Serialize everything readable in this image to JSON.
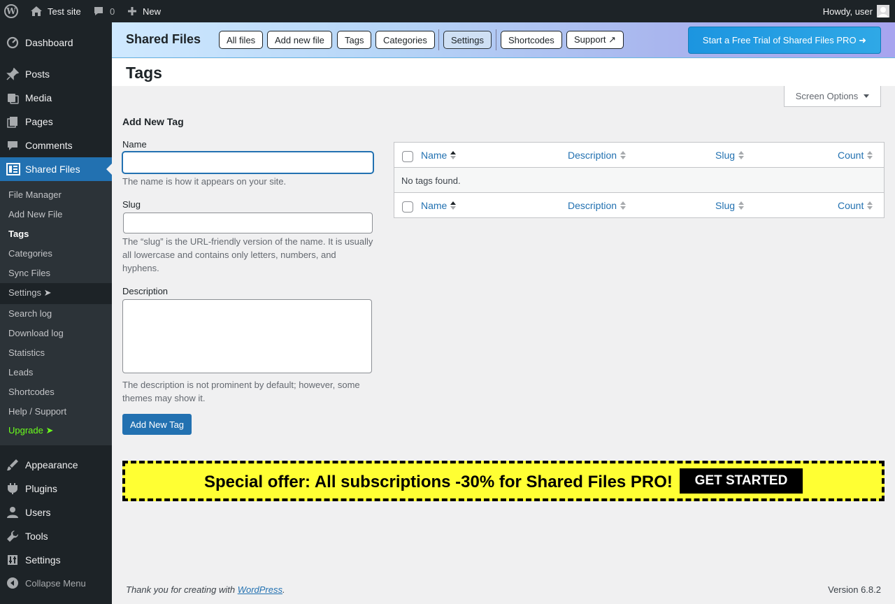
{
  "adminbar": {
    "site_name": "Test site",
    "comments_count": "0",
    "new_label": "New",
    "greeting": "Howdy, user"
  },
  "sidebar": {
    "top_items": [
      {
        "label": "Dashboard",
        "icon": "dashboard-icon"
      },
      {
        "label": "Posts",
        "icon": "pushpin-icon"
      },
      {
        "label": "Media",
        "icon": "media-icon"
      },
      {
        "label": "Pages",
        "icon": "pages-icon"
      },
      {
        "label": "Comments",
        "icon": "comment-icon"
      },
      {
        "label": "Shared Files",
        "icon": "shared-files-icon"
      }
    ],
    "submenu": [
      {
        "label": "File Manager"
      },
      {
        "label": "Add New File"
      },
      {
        "label": "Tags"
      },
      {
        "label": "Categories"
      },
      {
        "label": "Sync Files"
      },
      {
        "label": "Settings ➤"
      },
      {
        "label": "Search log"
      },
      {
        "label": "Download log"
      },
      {
        "label": "Statistics"
      },
      {
        "label": "Leads"
      },
      {
        "label": "Shortcodes"
      },
      {
        "label": "Help / Support"
      },
      {
        "label": "Upgrade ➤"
      }
    ],
    "bottom_items": [
      {
        "label": "Appearance",
        "icon": "appearance-icon"
      },
      {
        "label": "Plugins",
        "icon": "plugins-icon"
      },
      {
        "label": "Users",
        "icon": "users-icon"
      },
      {
        "label": "Tools",
        "icon": "tools-icon"
      },
      {
        "label": "Settings",
        "icon": "settings-icon"
      }
    ],
    "collapse_label": "Collapse Menu"
  },
  "plugin_header": {
    "title": "Shared Files",
    "nav": [
      "All files",
      "Add new file",
      "Tags",
      "Categories",
      "Settings",
      "Shortcodes",
      "Support ↗"
    ],
    "active_nav": "Settings",
    "trial_label": "Start a Free Trial of Shared Files PRO ➜"
  },
  "page": {
    "title": "Tags",
    "screen_options": "Screen Options"
  },
  "form": {
    "heading": "Add New Tag",
    "name_label": "Name",
    "name_value": "",
    "name_help": "The name is how it appears on your site.",
    "slug_label": "Slug",
    "slug_value": "",
    "slug_help": "The “slug” is the URL-friendly version of the name. It is usually all lowercase and contains only letters, numbers, and hyphens.",
    "description_label": "Description",
    "description_value": "",
    "description_help": "The description is not prominent by default; however, some themes may show it.",
    "submit_label": "Add New Tag"
  },
  "table": {
    "columns": [
      "Name",
      "Description",
      "Slug",
      "Count"
    ],
    "sorted_column": "Name",
    "empty_message": "No tags found."
  },
  "offer": {
    "text": "Special offer: All subscriptions -30% for Shared Files PRO!",
    "button": "GET STARTED"
  },
  "footer": {
    "thanks_prefix": "Thank you for creating with ",
    "wp_link": "WordPress",
    "thanks_suffix": ".",
    "version": "Version 6.8.2"
  },
  "colors": {
    "admin_dark": "#1d2327",
    "accent": "#2271b1",
    "upgrade": "#6bff1c",
    "offer_bg": "#ffff33"
  }
}
